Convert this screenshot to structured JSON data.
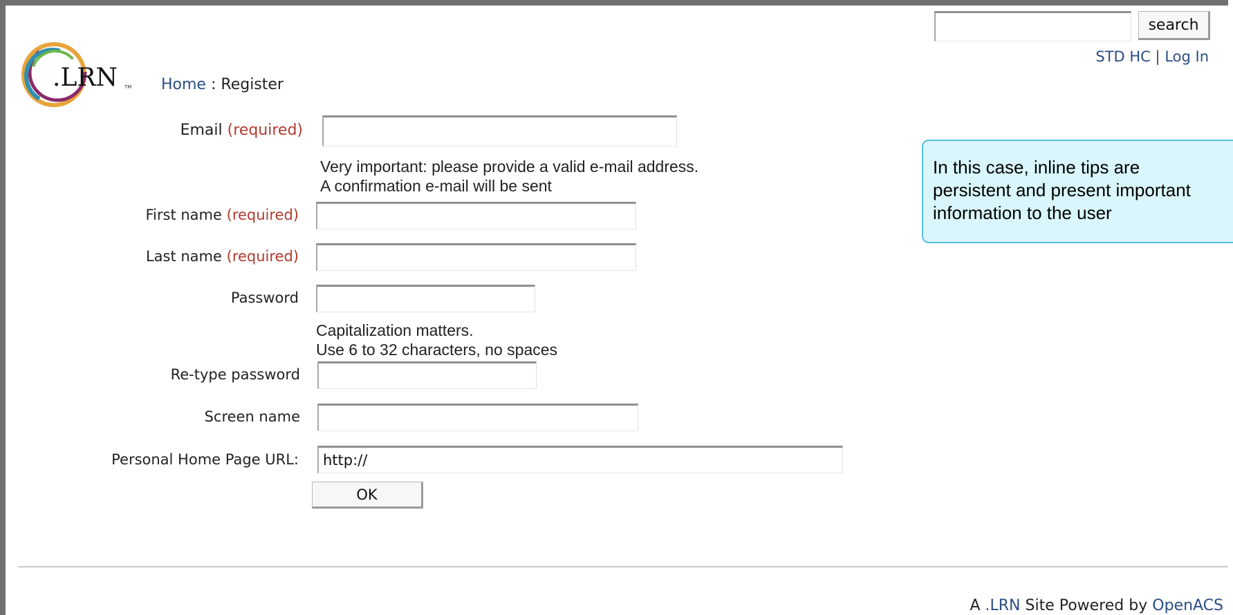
{
  "header": {
    "search_button": "search",
    "user_name": "STD HC",
    "separator": "|",
    "login_link": "Log In",
    "logo_text": ".LRN",
    "logo_tm": "TM"
  },
  "breadcrumb": {
    "home": "Home",
    "separator": ":",
    "current": "Register"
  },
  "form": {
    "email_label": "Email",
    "required": "(required)",
    "email_tip_line1": "Very important: please provide a valid e-mail address.",
    "email_tip_line2": "A confirmation e-mail will be sent",
    "first_name_label": "First name",
    "last_name_label": "Last name",
    "password_label": "Password",
    "password_tip_line1": "Capitalization matters.",
    "password_tip_line2": "Use 6 to 32 characters, no spaces",
    "retype_password_label": "Re-type password",
    "screen_name_label": "Screen name",
    "url_label": "Personal Home Page URL:",
    "url_value": "http://",
    "ok_button": "OK"
  },
  "callout": {
    "line1": "In this case, inline tips are",
    "line2": "persistent and present important",
    "line3": "information to the user"
  },
  "footer": {
    "prefix": "A",
    "lrn_link": ".LRN",
    "middle": "Site Powered by",
    "openacs_link": "OpenACS"
  },
  "colors": {
    "link": "#2a4d84",
    "required": "#b03a2e",
    "callout_bg": "#d8f6fb",
    "callout_border": "#55c0e0"
  }
}
